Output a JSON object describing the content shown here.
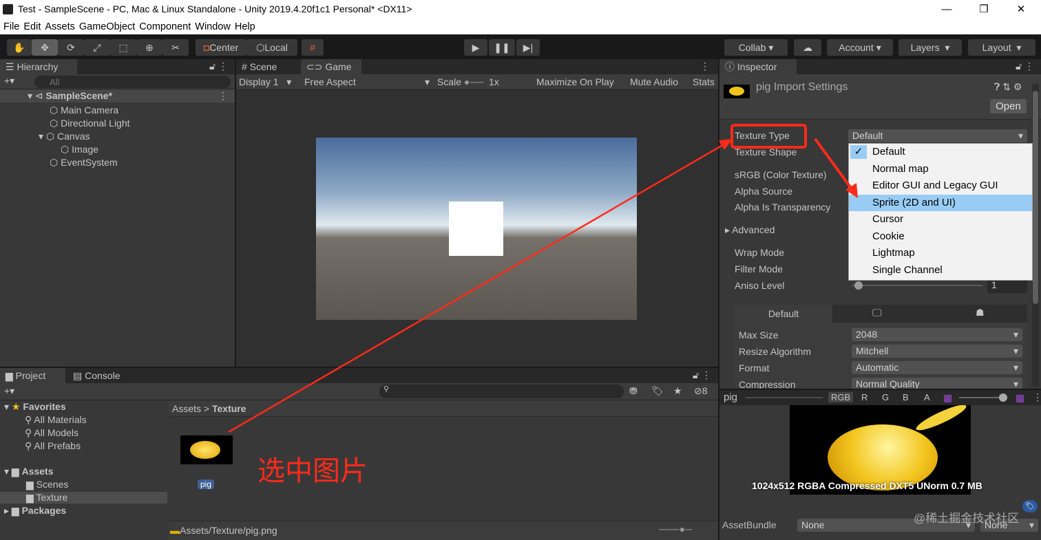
{
  "window": {
    "title": "Test - SampleScene - PC, Mac & Linux Standalone - Unity 2019.4.20f1c1 Personal* <DX11>",
    "minimize": "—",
    "maximize": "❐",
    "close": "✕"
  },
  "menu": [
    "File",
    "Edit",
    "Assets",
    "GameObject",
    "Component",
    "Window",
    "Help"
  ],
  "toolbar": {
    "center": "Center",
    "local": "Local",
    "collab": "Collab",
    "account": "Account",
    "layers": "Layers",
    "layout": "Layout"
  },
  "hierarchy": {
    "tab": "Hierarchy",
    "search_placeholder": "All",
    "scene": "SampleScene*",
    "items": [
      "Main Camera",
      "Directional Light",
      "Canvas",
      "Image",
      "EventSystem"
    ]
  },
  "game": {
    "tabs": [
      "Scene",
      "Game"
    ],
    "display": "Display 1",
    "aspect": "Free Aspect",
    "scale_label": "Scale",
    "scale_value": "1x",
    "maximize": "Maximize On Play",
    "mute": "Mute Audio",
    "stats": "Stats"
  },
  "project": {
    "tabs": [
      "Project",
      "Console"
    ],
    "hidden_count": "8",
    "favorites": "Favorites",
    "fav_items": [
      "All Materials",
      "All Models",
      "All Prefabs"
    ],
    "assets": "Assets",
    "asset_items": [
      "Scenes",
      "Texture"
    ],
    "packages": "Packages",
    "breadcrumb": [
      "Assets",
      "Texture"
    ],
    "file_label": "pig",
    "path": "Assets/Texture/pig.png"
  },
  "inspector": {
    "tab": "Inspector",
    "title": "pig Import Settings",
    "open": "Open",
    "labels": [
      "Texture Type",
      "Texture Shape",
      "sRGB (Color Texture)",
      "Alpha Source",
      "Alpha Is Transparency",
      "Advanced",
      "Wrap Mode",
      "Filter Mode",
      "Aniso Level"
    ],
    "texture_type": "Default",
    "aniso": "1",
    "dropdown": [
      "Default",
      "Normal map",
      "Editor GUI and Legacy GUI",
      "Sprite (2D and UI)",
      "Cursor",
      "Cookie",
      "Lightmap",
      "Single Channel"
    ],
    "platform_tab": "Default",
    "settings": [
      {
        "label": "Max Size",
        "value": "2048"
      },
      {
        "label": "Resize Algorithm",
        "value": "Mitchell"
      },
      {
        "label": "Format",
        "value": "Automatic"
      },
      {
        "label": "Compression",
        "value": "Normal Quality"
      }
    ],
    "preview_name": "pig",
    "channels": [
      "RGB",
      "R",
      "G",
      "B",
      "A"
    ],
    "info": "1024x512  RGBA Compressed DXT5 UNorm   0.7 MB",
    "assetbundle_label": "AssetBundle",
    "assetbundle": "None",
    "variant": "None"
  },
  "annotation": {
    "text": "选中图片",
    "watermark": "@稀土掘金技术社区",
    "color": "#ff2a1a"
  }
}
